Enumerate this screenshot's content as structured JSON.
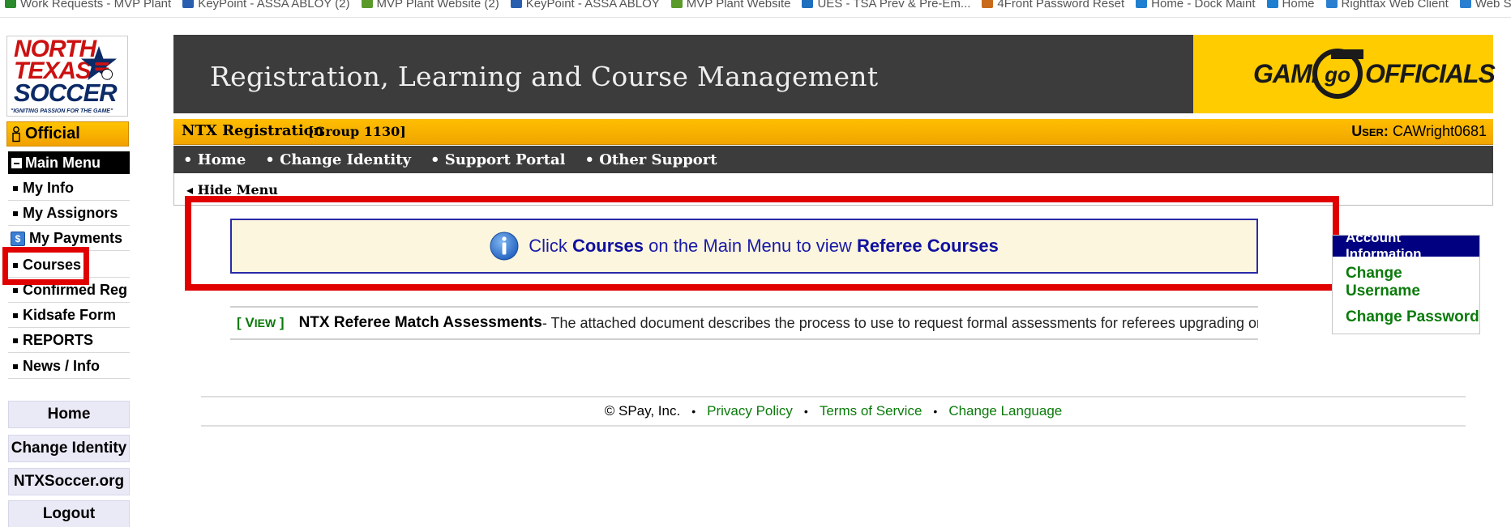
{
  "favorites": [
    {
      "label": "Work Requests - MVP Plant",
      "color": "#2b8a2b"
    },
    {
      "label": "KeyPoint - ASSA ABLOY (2)",
      "color": "#2a5fb0"
    },
    {
      "label": "MVP Plant Website (2)",
      "color": "#5a9a2a"
    },
    {
      "label": "KeyPoint - ASSA ABLOY",
      "color": "#2a5fb0"
    },
    {
      "label": "MVP Plant Website",
      "color": "#5a9a2a"
    },
    {
      "label": "UES - TSA Prev & Pre-Em...",
      "color": "#1f6fbf"
    },
    {
      "label": "4Front Password Reset",
      "color": "#c86a1a"
    },
    {
      "label": "Home - Dock Maint",
      "color": "#1e7fd0"
    },
    {
      "label": "Home",
      "color": "#1e7fd0"
    },
    {
      "label": "Rightfax Web Client",
      "color": "#2a7fd0"
    },
    {
      "label": "Web Slice Gallery",
      "color": "#2a7fd0"
    }
  ],
  "logo": {
    "line1": "NORTH",
    "line2": "TEXAS",
    "line3": "SOCCER",
    "tagline": "\"IGNITING PASSION FOR THE GAME\""
  },
  "sidebar": {
    "role": "Official",
    "menu_title": "Main Menu",
    "items": [
      {
        "label": "My Info"
      },
      {
        "label": "My Assignors"
      },
      {
        "label": "My Payments"
      },
      {
        "label": "Courses"
      },
      {
        "label": "Confirmed Reg"
      },
      {
        "label": "Kidsafe Form"
      },
      {
        "label": "REPORTS"
      },
      {
        "label": "News / Info"
      }
    ],
    "buttons": [
      {
        "label": "Home"
      },
      {
        "label": "Change Identity"
      },
      {
        "label": "NTXSoccer.org"
      },
      {
        "label": "Logout"
      }
    ]
  },
  "header": {
    "title": "Registration, Learning and Course Management",
    "brand_left": "GAME",
    "brand_mid": "go",
    "brand_right": "OFFICIALS"
  },
  "regbar": {
    "title": "NTX Registration",
    "group": "[Group 1130]",
    "user_label": "User:",
    "user_name": "CAWright0681"
  },
  "nav": [
    {
      "label": "• Home"
    },
    {
      "label": "• Change Identity"
    },
    {
      "label": "• Support Portal"
    },
    {
      "label": "• Other Support"
    }
  ],
  "hide_menu": "◂ Hide Menu",
  "notice": {
    "part1": "Click ",
    "bold1": "Courses",
    "part2": " on the Main Menu to view ",
    "bold2": "Referee Courses"
  },
  "account": {
    "heading": "Account Information",
    "links": [
      {
        "label": "Change Username"
      },
      {
        "label": "Change Password"
      }
    ]
  },
  "document": {
    "view_open": "[ V",
    "view_rest": "IEW",
    "view_close": " ]",
    "title": "NTX Referee Match Assessments",
    "description": " - The attached document describes the process to use to request formal assessments for referees upgrading or"
  },
  "footer": {
    "copyright": "© SPay, Inc.",
    "links": [
      {
        "label": "Privacy Policy"
      },
      {
        "label": "Terms of Service"
      },
      {
        "label": "Change Language"
      }
    ],
    "separator": "•"
  },
  "colors": {
    "accent_yellow": "#ffbe00",
    "header_dark": "#3c3c3c",
    "link_green": "#0a7a0a",
    "notice_blue": "#1a1aa8",
    "annotation_red": "#e00000"
  }
}
